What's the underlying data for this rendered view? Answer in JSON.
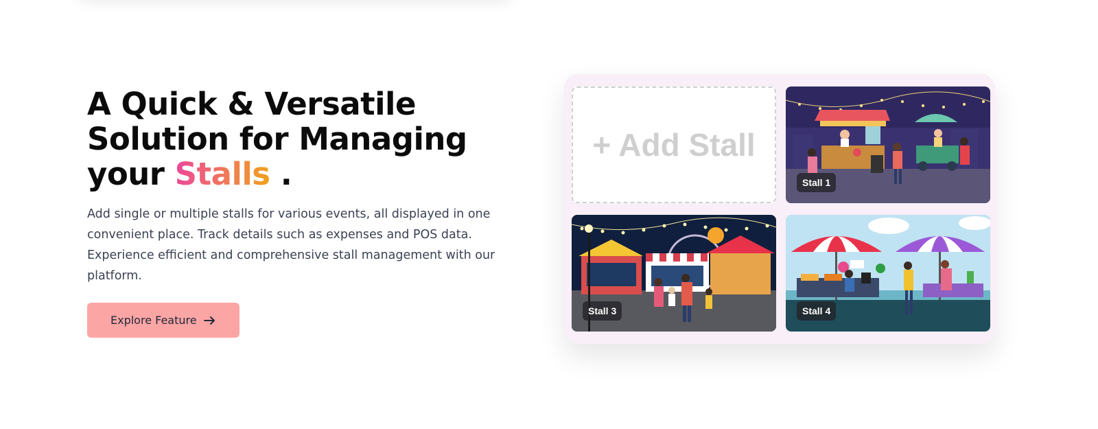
{
  "hero": {
    "title_line1": "A Quick & Versatile",
    "title_line2": "Solution for Managing",
    "title_line3_prefix": "your",
    "title_accent": "Stalls",
    "title_suffix": ".",
    "description": "Add single or multiple stalls for various events, all displayed in one convenient place. Track details such as expenses and POS data. Experience efficient and comprehensive stall management with our platform.",
    "cta_label": "Explore Feature"
  },
  "stalls": {
    "add_label": "+ Add Stall",
    "items": [
      {
        "label": "Stall 1",
        "icon": "night-market-illustration"
      },
      {
        "label": "Stall 3",
        "icon": "carnival-fair-illustration"
      },
      {
        "label": "Stall 4",
        "icon": "flea-market-illustration"
      }
    ]
  },
  "colors": {
    "accent_gradient": [
      "#ec4899",
      "#f07a57",
      "#f0a21b"
    ],
    "cta_background": "#fca5a5",
    "panel_background": "#f8eff8"
  }
}
